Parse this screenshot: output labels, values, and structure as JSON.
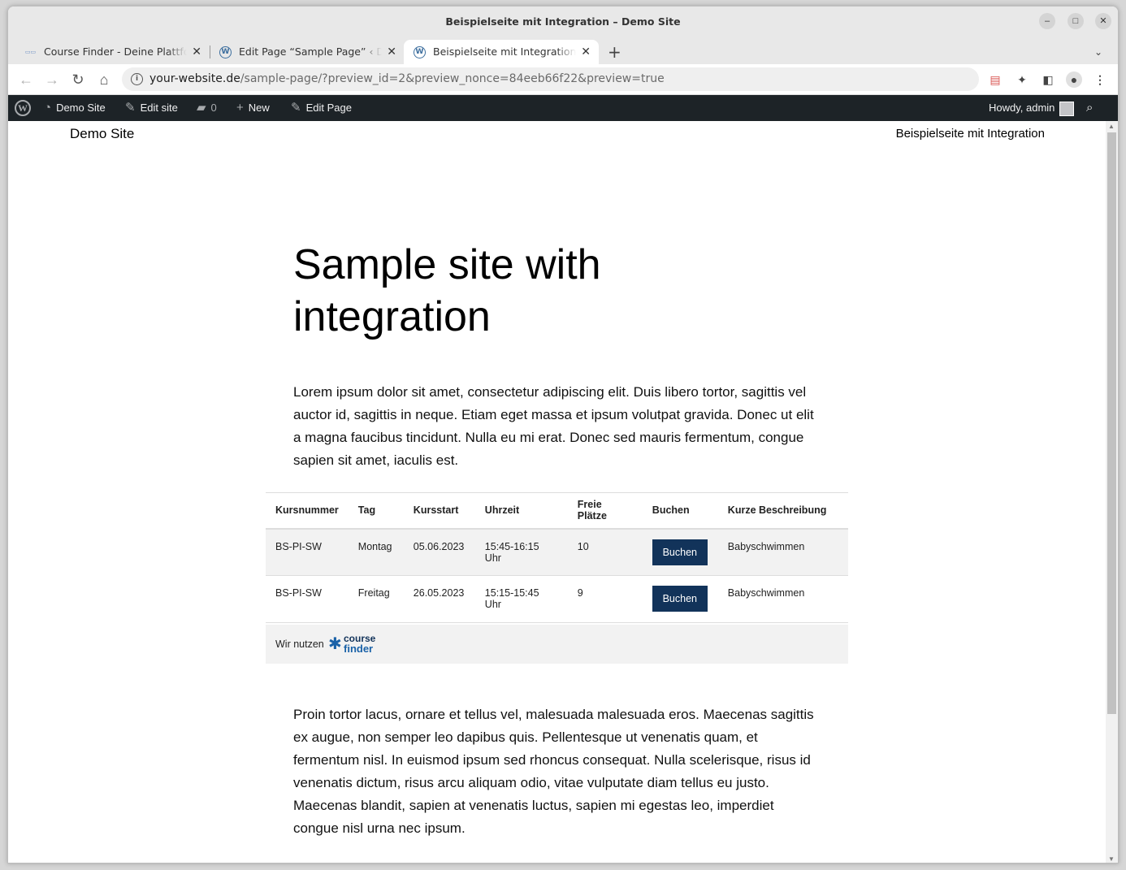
{
  "window": {
    "title": "Beispielseite mit Integration – Demo Site"
  },
  "tabs": [
    {
      "label": "Course Finder - Deine Plattform",
      "favicon": "course-finder-favicon"
    },
    {
      "label": "Edit Page “Sample Page” ‹ Demo Site",
      "favicon": "wordpress-favicon"
    },
    {
      "label": "Beispielseite mit Integration – Demo Site",
      "favicon": "wordpress-favicon"
    }
  ],
  "address_bar": {
    "host": "your-website.de",
    "path": "/sample-page/?preview_id=2&preview_nonce=84eeb66f22&preview=true"
  },
  "admin_bar": {
    "site_name": "Demo Site",
    "edit_site": "Edit site",
    "comments_count": "0",
    "new": "New",
    "edit_page": "Edit Page",
    "howdy": "Howdy, admin"
  },
  "site": {
    "title": "Demo Site",
    "nav_link": "Beispielseite mit Integration"
  },
  "page": {
    "heading": "Sample site with integration",
    "intro": "Lorem ipsum dolor sit amet, consectetur adipiscing elit. Duis libero tortor, sagittis vel auctor id, sagittis in neque. Etiam eget massa et ipsum volutpat gravida. Donec ut elit a magna faucibus tincidunt. Nulla eu mi erat. Donec sed mauris fermentum, congue sapien sit amet, iaculis est.",
    "outro": "Proin tortor lacus, ornare et tellus vel, malesuada malesuada eros. Maecenas sagittis ex augue, non semper leo dapibus quis. Pellentesque ut venenatis quam, et fermentum nisl. In euismod ipsum sed rhoncus consequat. Nulla scelerisque, risus id venenatis dictum, risus arcu aliquam odio, vitae vulputate diam tellus eu justo. Maecenas blandit, sapien at venenatis luctus, sapien mi egestas leo, imperdiet congue nisl urna nec ipsum."
  },
  "course_table": {
    "headers": [
      "Kursnummer",
      "Tag",
      "Kursstart",
      "Uhrzeit",
      "Freie Plätze",
      "Buchen",
      "Kurze Beschreibung"
    ],
    "rows": [
      {
        "kursnummer": "BS-PI-SW",
        "tag": "Montag",
        "kursstart": "05.06.2023",
        "uhrzeit": "15:45-16:15 Uhr",
        "freie_plaetze": "10",
        "button": "Buchen",
        "beschreibung": "Babyschwimmen"
      },
      {
        "kursnummer": "BS-PI-SW",
        "tag": "Freitag",
        "kursstart": "26.05.2023",
        "uhrzeit": "15:15-15:45 Uhr",
        "freie_plaetze": "9",
        "button": "Buchen",
        "beschreibung": "Babyschwimmen"
      }
    ],
    "powered_by": "Wir nutzen",
    "logo_line1": "course",
    "logo_line2": "finder"
  },
  "colors": {
    "wp_admin_bar": "#1d2327",
    "button_primary": "#12335a",
    "logo_blue": "#1a62a8"
  }
}
